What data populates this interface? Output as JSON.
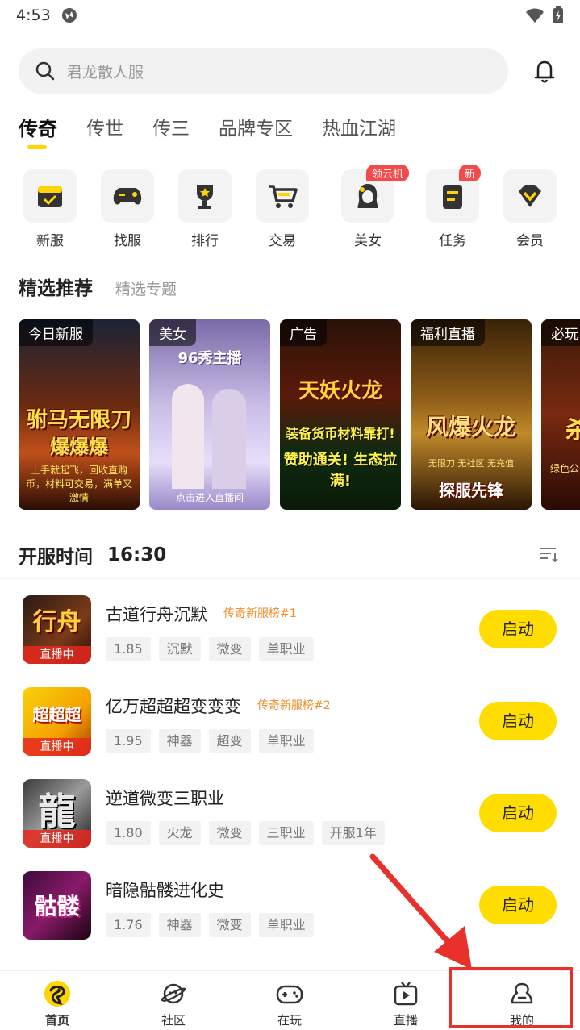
{
  "status": {
    "time": "4:53"
  },
  "search": {
    "placeholder": "君龙散人服"
  },
  "tabs": [
    "传奇",
    "传世",
    "传三",
    "品牌专区",
    "热血江湖"
  ],
  "quick_items": [
    {
      "label": "新服",
      "icon": "calendar-check-icon"
    },
    {
      "label": "找服",
      "icon": "gamepad-icon"
    },
    {
      "label": "排行",
      "icon": "trophy-icon"
    },
    {
      "label": "交易",
      "icon": "cart-icon"
    },
    {
      "label": "美女",
      "icon": "woman-icon",
      "badge": "领云机"
    },
    {
      "label": "任务",
      "icon": "task-icon",
      "badge": "新"
    },
    {
      "label": "会员",
      "icon": "diamond-icon"
    }
  ],
  "featured": {
    "title": "精选推荐",
    "subtitle": "精选专题"
  },
  "cards": [
    {
      "tag": "今日新服",
      "big1": "驸马无限刀",
      "big2": "爆爆爆",
      "small": "上手就起飞，回收直购币，材料可交易，满单又激情"
    },
    {
      "tag": "美女",
      "big1": "96秀主播",
      "big2": "",
      "small": "点击进入直播间"
    },
    {
      "tag": "广告",
      "big1": "天妖火龙",
      "big2": "装备货币材料靠打!",
      "small": "赞助通关! 生态拉满!"
    },
    {
      "tag": "福利直播",
      "big1": "风爆火龙",
      "big2": "探服先锋",
      "small": "无限刀 无社区 无充值"
    },
    {
      "tag": "必玩",
      "big1": "杀",
      "big2": "",
      "small": "绿色公平"
    }
  ],
  "open_time": {
    "title": "开服时间",
    "time": "16:30"
  },
  "games": [
    {
      "name": "古道行舟沉默",
      "rank": "传奇新服榜#1",
      "tags": [
        "1.85",
        "沉默",
        "微变",
        "单职业"
      ],
      "live": "直播中",
      "icon_text": "行舟",
      "button": "启动"
    },
    {
      "name": "亿万超超超变变变",
      "rank": "传奇新服榜#2",
      "tags": [
        "1.95",
        "神器",
        "超变",
        "单职业"
      ],
      "live": "直播中",
      "icon_text": "超超超",
      "button": "启动"
    },
    {
      "name": "逆道微变三职业",
      "rank": "",
      "tags": [
        "1.80",
        "火龙",
        "微变",
        "三职业",
        "开服1年"
      ],
      "live": "直播中",
      "icon_text": "龍",
      "button": "启动"
    },
    {
      "name": "暗隐骷髅进化史",
      "rank": "",
      "tags": [
        "1.76",
        "神器",
        "微变",
        "单职业"
      ],
      "live": "",
      "icon_text": "骷髅",
      "button": "启动"
    }
  ],
  "nav": [
    {
      "label": "首页",
      "icon": "home-icon"
    },
    {
      "label": "社区",
      "icon": "planet-icon"
    },
    {
      "label": "在玩",
      "icon": "controller-icon"
    },
    {
      "label": "直播",
      "icon": "tv-icon"
    },
    {
      "label": "我的",
      "icon": "profile-icon"
    }
  ],
  "colors": {
    "accent": "#FFDD00",
    "badge": "#f34b4b",
    "rank": "#f08a24",
    "highlight": "#e8312b"
  }
}
